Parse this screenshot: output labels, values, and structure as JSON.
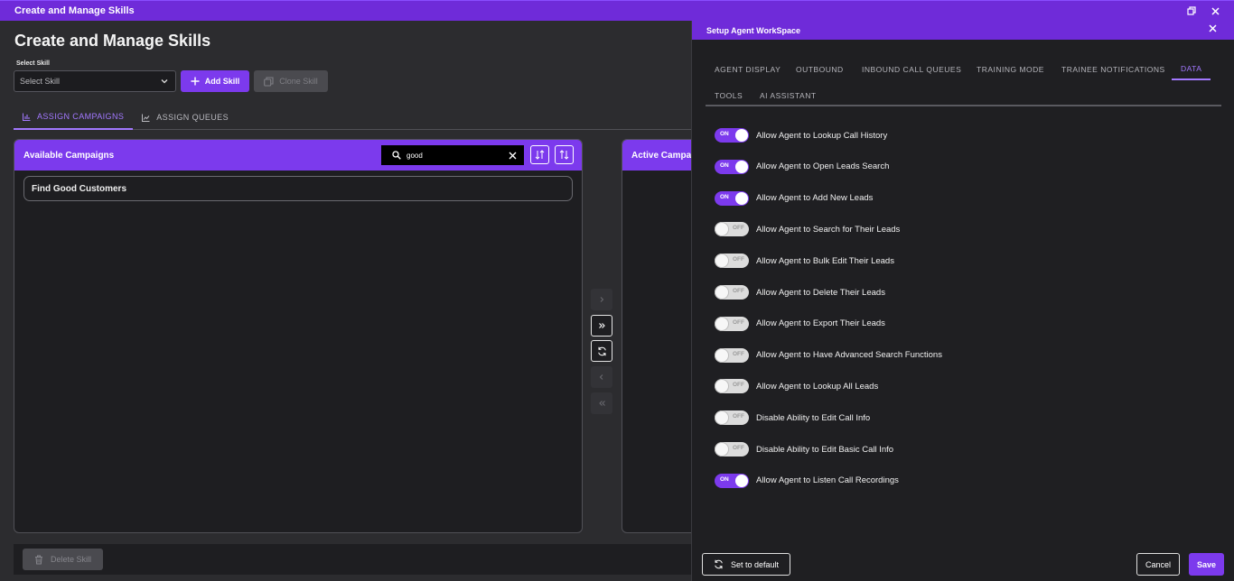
{
  "window": {
    "title": "Create and Manage Skills"
  },
  "page": {
    "title": "Create and Manage Skills",
    "select_skill_label": "Select Skill",
    "select_skill_placeholder": "Select Skill",
    "add_skill": "Add Skill",
    "clone_skill": "Clone Skill",
    "delete_skill": "Delete Skill"
  },
  "left_tabs": [
    {
      "label": "ASSIGN CAMPAIGNS",
      "active": true
    },
    {
      "label": "ASSIGN QUEUES",
      "active": false
    }
  ],
  "available_panel": {
    "title": "Available Campaigns",
    "search_value": "good",
    "items": [
      "Find Good Customers"
    ]
  },
  "active_panel": {
    "title": "Active Campaigns"
  },
  "dialog": {
    "title": "Setup Agent WorkSpace",
    "tabs": [
      {
        "label": "AGENT DISPLAY",
        "active": false
      },
      {
        "label": "OUTBOUND",
        "active": false
      },
      {
        "label": "INBOUND CALL QUEUES",
        "active": false
      },
      {
        "label": "TRAINING MODE",
        "active": false
      },
      {
        "label": "TRAINEE NOTIFICATIONS",
        "active": false
      },
      {
        "label": "DATA",
        "active": true
      },
      {
        "label": "TOOLS",
        "active": false
      },
      {
        "label": "AI ASSISTANT",
        "active": false
      }
    ],
    "on_text": "ON",
    "off_text": "OFF",
    "toggles": [
      {
        "label": "Allow Agent to Lookup Call History",
        "on": true
      },
      {
        "label": "Allow Agent to Open Leads Search",
        "on": true
      },
      {
        "label": "Allow Agent to Add New Leads",
        "on": true
      },
      {
        "label": "Allow Agent to Search for Their Leads",
        "on": false
      },
      {
        "label": "Allow Agent to Bulk Edit Their Leads",
        "on": false
      },
      {
        "label": "Allow Agent to Delete Their Leads",
        "on": false
      },
      {
        "label": "Allow Agent to Export Their Leads",
        "on": false
      },
      {
        "label": "Allow Agent to Have Advanced Search Functions",
        "on": false
      },
      {
        "label": "Allow Agent to Lookup All Leads",
        "on": false
      },
      {
        "label": "Disable Ability to Edit Call Info",
        "on": false
      },
      {
        "label": "Disable Ability to Edit Basic Call Info",
        "on": false
      },
      {
        "label": "Allow Agent to Listen Call Recordings",
        "on": true
      }
    ],
    "set_default": "Set to default",
    "cancel": "Cancel",
    "save": "Save"
  },
  "colors": {
    "accent": "#7c3aed",
    "titlebar": "#6f2bd9",
    "active_tab": "#a278ff"
  }
}
